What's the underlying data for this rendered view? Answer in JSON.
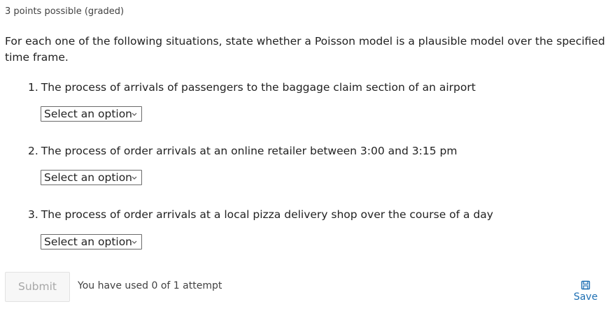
{
  "problem": {
    "points_text": "3 points possible (graded)",
    "prompt": "For each one of the following situations, state whether a Poisson model is a plausible model over the specified time frame."
  },
  "questions": [
    {
      "number": "1.",
      "text": "The process of arrivals of passengers to the baggage claim section of an airport",
      "selected": "Select an option"
    },
    {
      "number": "2.",
      "text": "The process of order arrivals at an online retailer between 3:00 and 3:15 pm",
      "selected": "Select an option"
    },
    {
      "number": "3.",
      "text": "The process of order arrivals at a local pizza delivery shop over the course of a day",
      "selected": "Select an option"
    }
  ],
  "actions": {
    "submit_label": "Submit",
    "attempts_text": "You have used 0 of 1 attempt",
    "save_label": "Save",
    "save_icon": "floppy-disk-icon"
  },
  "colors": {
    "link": "#1d6fb3",
    "submit_disabled_text": "#a8a8a8"
  }
}
